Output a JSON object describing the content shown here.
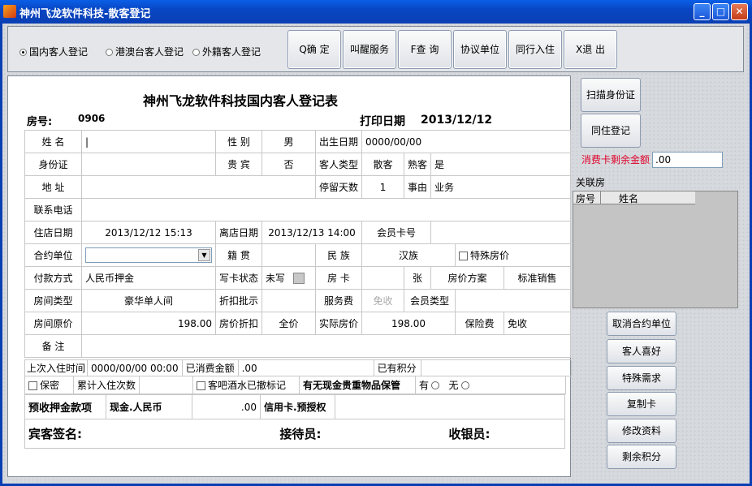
{
  "window": {
    "title": "神州飞龙软件科技-散客登记"
  },
  "radios": [
    {
      "label": "国内客人登记",
      "checked": true
    },
    {
      "label": "港澳台客人登记",
      "checked": false
    },
    {
      "label": "外籍客人登记",
      "checked": false
    }
  ],
  "toolbar": {
    "confirm": "Q确  定",
    "wake": "叫醒服务",
    "query": "F查  询",
    "agreement": "协议单位",
    "peer": "同行入住",
    "exit": "X退  出"
  },
  "form": {
    "title": "神州飞龙软件科技国内客人登记表",
    "room_label": "房号:",
    "room_no": "0906",
    "print_label": "打印日期",
    "print_date": "2013/12/12",
    "name_label": "姓    名",
    "name_value": "|",
    "gender_label": "性  别",
    "gender_value": "男",
    "birth_label": "出生日期",
    "birth_value": "0000/00/00",
    "id_label": "身份证",
    "vip_label": "贵  宾",
    "vip_value": "否",
    "guest_type_label": "客人类型",
    "guest_type_value": "散客",
    "regular_label": "熟客",
    "regular_value": "是",
    "address_label": "地    址",
    "stay_days_label": "停留天数",
    "stay_days_value": "1",
    "reason_label": "事由",
    "reason_value": "业务",
    "phone_label": "联系电话",
    "checkin_label": "住店日期",
    "checkin_value": "2013/12/12 15:13",
    "checkout_label": "离店日期",
    "checkout_value": "2013/12/13 14:00",
    "member_card_label": "会员卡号",
    "contract_label": "合约单位",
    "native_label": "籍  贯",
    "ethnic_label": "民  族",
    "ethnic_value": "汉族",
    "special_price_label": "特殊房价",
    "payment_label": "付款方式",
    "payment_value": "人民币押金",
    "card_status_label": "写卡状态",
    "card_status_value": "未写",
    "room_card_label": "房  卡",
    "card_unit": "张",
    "price_plan_label": "房价方案",
    "price_plan_value": "标准销售",
    "room_type_label": "房间类型",
    "room_type_value": "豪华单人间",
    "discount_approve_label": "折扣批示",
    "service_fee_label": "服务费",
    "service_fee_value": "免收",
    "member_type_label": "会员类型",
    "orig_price_label": "房间原价",
    "orig_price_value": "198.00",
    "discount_label": "房价折扣",
    "discount_value": "全价",
    "actual_price_label": "实际房价",
    "actual_price_value": "198.00",
    "insurance_label": "保险费",
    "insurance_value": "免收",
    "remark_label": "备    注",
    "last_stay_label": "上次入住时间",
    "last_stay_value": "0000/00/00 00:00",
    "spent_label": "已消费金额",
    "spent_value": ".00",
    "points_label": "已有积分",
    "secret_label": "保密",
    "count_label": "累计入住次数",
    "minibar_label": "客吧酒水已撤标记",
    "valuables_label": "有无现金贵重物品保管",
    "yes_label": "有",
    "no_label": "无",
    "deposit_label": "预收押金款项",
    "deposit_type": "现金.人民币",
    "deposit_amount": ".00",
    "credit_label": "信用卡.预授权",
    "guest_sign": "宾客签名:",
    "receptionist": "接待员:",
    "cashier": "收银员:"
  },
  "side": {
    "scan_id": "扫描身份证",
    "co_register": "同住登记",
    "balance_label": "消费卡剩余金额",
    "balance_value": ".00",
    "linked_rooms": "关联房",
    "col_room": "房号",
    "col_name": "姓名",
    "cancel_contract": "取消合约单位",
    "preference": "客人喜好",
    "special_need": "特殊需求",
    "copy_card": "复制卡",
    "modify_info": "修改资料",
    "remaining_points": "剩余积分"
  },
  "colors": {
    "title_blue": "#0a46c4",
    "balance_red": "#e0002a"
  }
}
